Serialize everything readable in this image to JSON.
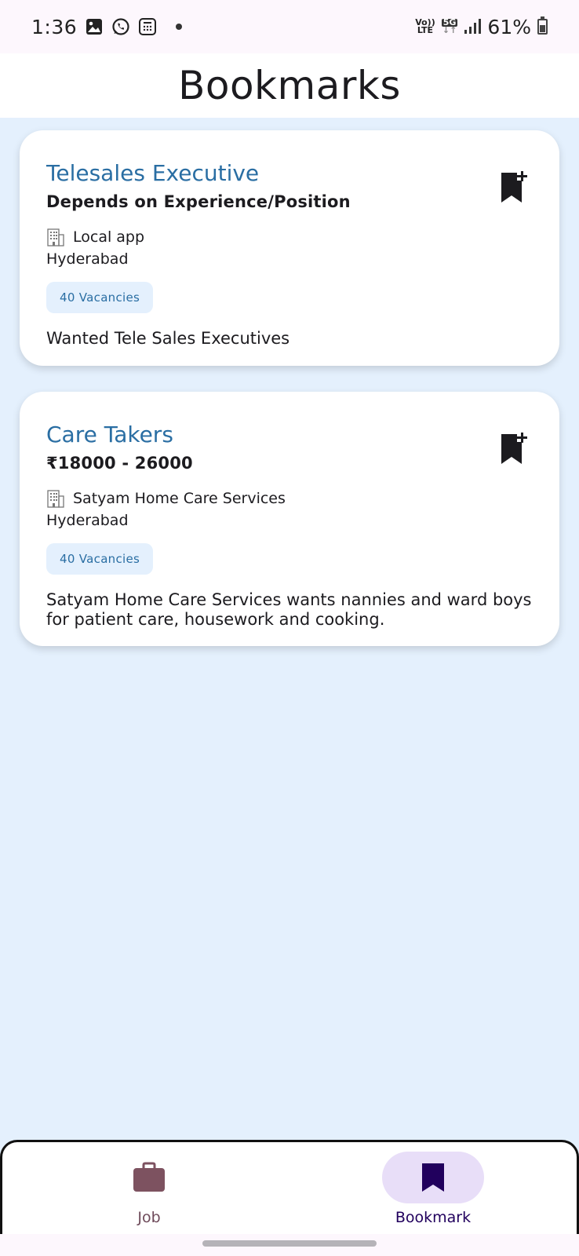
{
  "status_bar": {
    "time": "1:36",
    "net_top": "Vo))",
    "net_bottom": "LTE",
    "network": "5G",
    "battery": "61%"
  },
  "header": {
    "title": "Bookmarks"
  },
  "jobs": [
    {
      "title": "Telesales Executive",
      "salary": "Depends on Experience/Position",
      "company": "Local app",
      "location": "Hyderabad",
      "vacancies": "40 Vacancies",
      "description": "Wanted Tele Sales Executives",
      "bookmark_icon": "bookmark-add-icon"
    },
    {
      "title": "Care Takers",
      "salary": "₹18000 - 26000",
      "company": "Satyam Home Care Services",
      "location": "Hyderabad",
      "vacancies": "40 Vacancies",
      "description": "Satyam Home Care Services wants nannies and ward boys for patient care, housework and cooking.",
      "bookmark_icon": "bookmark-add-icon"
    }
  ],
  "bottom_nav": {
    "items": [
      {
        "label": "Job",
        "icon": "briefcase-icon",
        "selected": false
      },
      {
        "label": "Bookmark",
        "icon": "bookmark-icon",
        "selected": true
      }
    ]
  },
  "colors": {
    "accent": "#2a6ea3",
    "background": "#e4f0fd",
    "nav_selected_pill": "#e8def8",
    "nav_selected_icon": "#21005d",
    "nav_unselected_icon": "#7d5260"
  }
}
